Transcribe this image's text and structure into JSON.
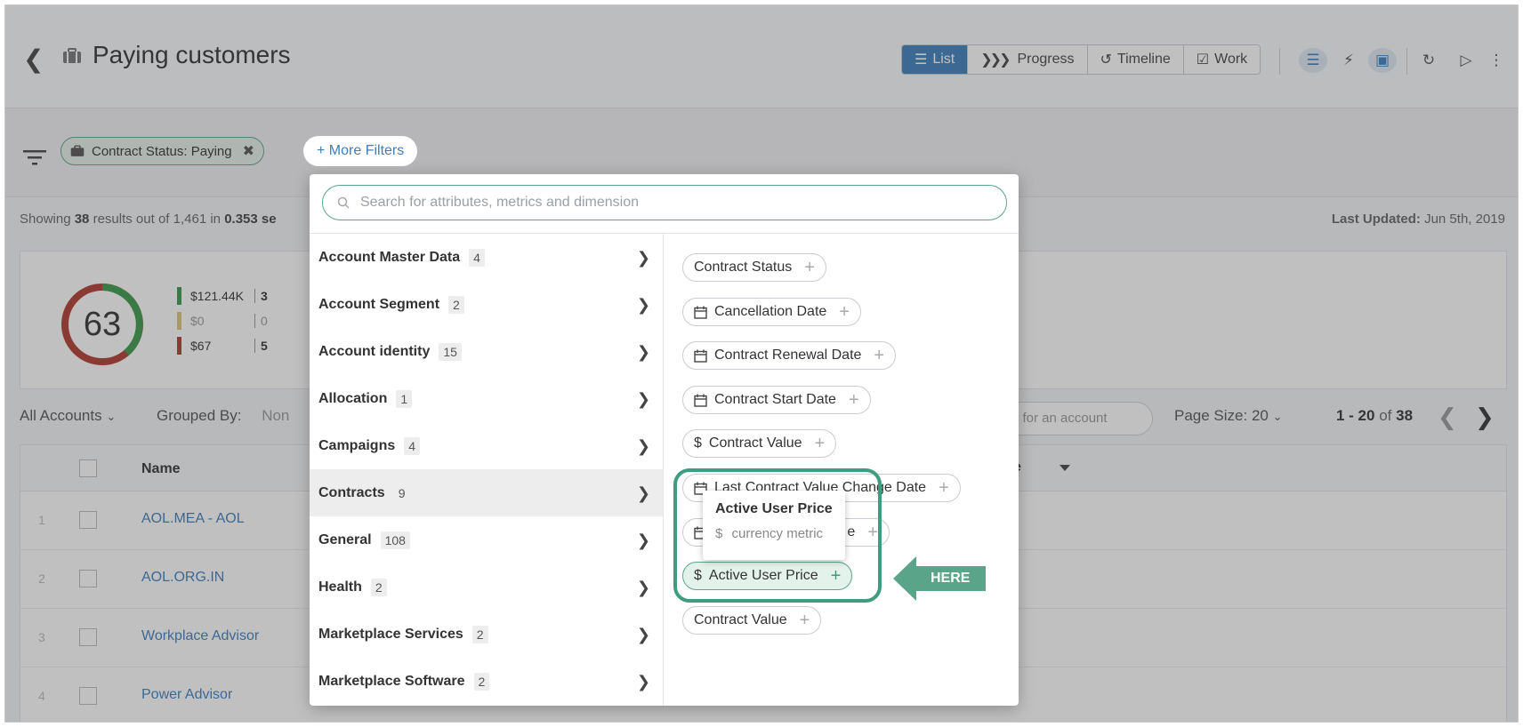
{
  "header": {
    "title": "Paying customers",
    "views": [
      {
        "label": "List",
        "active": true
      },
      {
        "label": "Progress",
        "active": false
      },
      {
        "label": "Timeline",
        "active": false
      },
      {
        "label": "Work",
        "active": false
      }
    ]
  },
  "filters": {
    "active_chip": "Contract Status: Paying",
    "more_filters": "+ More Filters"
  },
  "status": {
    "showing_prefix": "Showing",
    "result_count": "38",
    "results_mid": "results out of 1,461 in",
    "time": "0.353 se",
    "last_updated_label": "Last Updated:",
    "last_updated_value": "Jun 5th, 2019"
  },
  "summary": {
    "score": "63",
    "legend": [
      {
        "value": "$121.44K",
        "count": "3",
        "color": "#3a9a4a"
      },
      {
        "value": "$0",
        "count": "0",
        "color": "#d8c878"
      },
      {
        "value": "$67",
        "count": "5",
        "color": "#b03a2e"
      }
    ]
  },
  "toolbar": {
    "all_accounts": "All Accounts",
    "grouped_by_label": "Grouped By:",
    "grouped_by_value": "Non",
    "search_placeholder": "h for an account",
    "page_size": "Page Size: 20",
    "pager_range": "1 - 20",
    "pager_of": "of",
    "pager_total": "38"
  },
  "table": {
    "name_header": "Name",
    "header_partial": "e",
    "rows": [
      {
        "num": "1",
        "name": "AOL.MEA - AOL"
      },
      {
        "num": "2",
        "name": "AOL.ORG.IN"
      },
      {
        "num": "3",
        "name": "Workplace Advisor"
      },
      {
        "num": "4",
        "name": "Power Advisor"
      }
    ]
  },
  "popup": {
    "search_placeholder": "Search for attributes, metrics and dimension",
    "categories": [
      {
        "label": "Account Master Data",
        "count": "4"
      },
      {
        "label": "Account Segment",
        "count": "2"
      },
      {
        "label": "Account identity",
        "count": "15"
      },
      {
        "label": "Allocation",
        "count": "1"
      },
      {
        "label": "Campaigns",
        "count": "4"
      },
      {
        "label": "Contracts",
        "count": "9"
      },
      {
        "label": "General",
        "count": "108"
      },
      {
        "label": "Health",
        "count": "2"
      },
      {
        "label": "Marketplace Services",
        "count": "2"
      },
      {
        "label": "Marketplace Software",
        "count": "2"
      }
    ],
    "attributes": [
      {
        "label": "Contract Status",
        "icon": "none"
      },
      {
        "label": "Cancellation Date",
        "icon": "calendar-icon"
      },
      {
        "label": "Contract Renewal Date",
        "icon": "calendar-icon"
      },
      {
        "label": "Contract Start Date",
        "icon": "calendar-icon"
      },
      {
        "label": "Contract Value",
        "icon": "dollar-icon"
      },
      {
        "label": "Last Contract Value Change Date",
        "icon": "calendar-icon"
      },
      {
        "label": "e",
        "icon": "calendar-icon"
      },
      {
        "label": "Active User Price",
        "icon": "dollar-icon"
      },
      {
        "label": "Contract Value",
        "icon": "none"
      }
    ],
    "tooltip": {
      "title": "Active User Price",
      "currency_symbol": "$",
      "subtitle": "currency metric"
    }
  },
  "callout": {
    "label": "HERE"
  },
  "colors": {
    "accent_green": "#5aa58a",
    "accent_blue": "#3d7fbf"
  }
}
